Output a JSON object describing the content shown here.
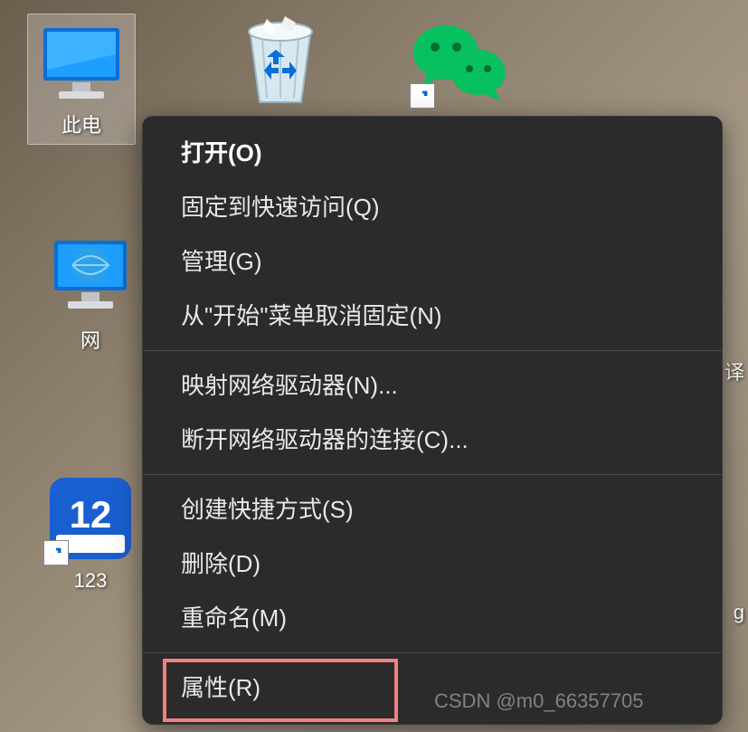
{
  "desktop_icons": {
    "this_pc": {
      "label": "此电",
      "label_full_cutoff": "此电"
    },
    "recycle_bin": {
      "label": ""
    },
    "wechat": {
      "label": ""
    },
    "network": {
      "label": "网"
    },
    "app123": {
      "label": "123"
    },
    "edge_right_1": {
      "label": "译"
    },
    "edge_right_2": {
      "label": "g"
    }
  },
  "context_menu": {
    "items": [
      {
        "label": "打开(O)",
        "bold": true
      },
      {
        "label": "固定到快速访问(Q)"
      },
      {
        "label": "管理(G)"
      },
      {
        "label": "从\"开始\"菜单取消固定(N)"
      },
      {
        "sep": true
      },
      {
        "label": "映射网络驱动器(N)..."
      },
      {
        "label": "断开网络驱动器的连接(C)..."
      },
      {
        "sep": true
      },
      {
        "label": "创建快捷方式(S)"
      },
      {
        "label": "删除(D)"
      },
      {
        "label": "重命名(M)"
      },
      {
        "sep": true
      },
      {
        "label": "属性(R)",
        "highlighted": true
      }
    ]
  },
  "watermark": "CSDN @m0_66357705"
}
